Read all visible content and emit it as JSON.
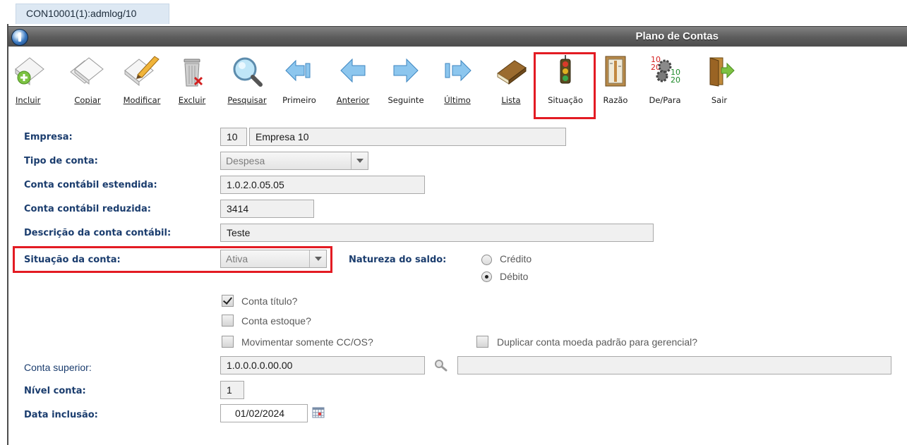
{
  "tab": {
    "label": "CON10001(1):admlog/10"
  },
  "window": {
    "title": "Plano de Contas"
  },
  "toolbar": {
    "incluir": "Incluir",
    "copiar": "Copiar",
    "modificar": "Modificar",
    "excluir": "Excluir",
    "pesquisar": "Pesquisar",
    "primeiro": "Primeiro",
    "anterior": "Anterior",
    "seguinte": "Seguinte",
    "ultimo": "Último",
    "lista": "Lista",
    "situacao": "Situação",
    "razao": "Razão",
    "depara": "De/Para",
    "sair": "Sair",
    "depara_nums": {
      "a": "10",
      "b": "20",
      "c": "10",
      "d": "20"
    }
  },
  "form": {
    "empresa": {
      "label": "Empresa:",
      "code": "10",
      "name": "Empresa 10"
    },
    "tipo_conta": {
      "label": "Tipo de conta:",
      "value": "Despesa"
    },
    "conta_estendida": {
      "label": "Conta contábil estendida:",
      "value": "1.0.2.0.05.05"
    },
    "conta_reduzida": {
      "label": "Conta contábil reduzida:",
      "value": "3414"
    },
    "descricao": {
      "label": "Descrição da conta contábil:",
      "value": "Teste"
    },
    "situacao": {
      "label": "Situação da conta:",
      "value": "Ativa"
    },
    "natureza": {
      "label": "Natureza do saldo:",
      "options": [
        "Crédito",
        "Débito"
      ],
      "selected": "Débito"
    },
    "checkboxes": {
      "conta_titulo": {
        "label": "Conta título?",
        "checked": true
      },
      "conta_estoque": {
        "label": "Conta estoque?",
        "checked": false
      },
      "movimentar_cc": {
        "label": "Movimentar somente CC/OS?",
        "checked": false
      },
      "duplicar_moeda": {
        "label": "Duplicar conta moeda padrão para gerencial?",
        "checked": false
      }
    },
    "conta_superior": {
      "label": "Conta superior:",
      "value": "1.0.0.0.0.00.00",
      "description": ""
    },
    "nivel_conta": {
      "label": "Nível conta:",
      "value": "1"
    },
    "data_inclusao": {
      "label": "Data inclusão:",
      "value": "01/02/2024"
    }
  },
  "colors": {
    "highlight": "#e31b23",
    "label": "#1b3d6e",
    "titlebar": "#5d5d5d"
  }
}
